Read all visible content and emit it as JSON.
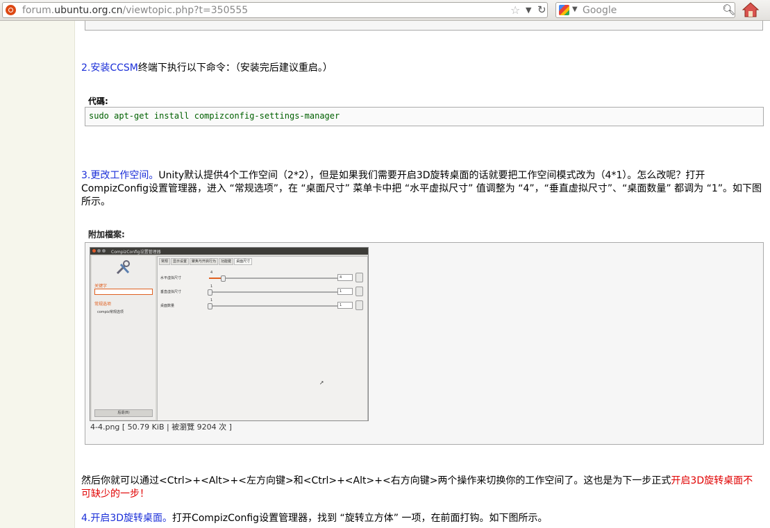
{
  "browser": {
    "url_prefix": "forum.",
    "url_domain": "ubuntu.org.cn",
    "url_suffix": "/viewtopic.php?t=350555",
    "search_placeholder": "Google"
  },
  "post": {
    "step2_link": "2.安装CCSM",
    "step2_text": "终端下执行以下命令：（安装完后建议重启。）",
    "code_label": "代碼:",
    "code": "sudo apt-get install compizconfig-settings-manager",
    "step3_link": "3.更改工作空间。",
    "step3_text1": "Unity默认提供4个工作空间（2*2），但是如果我们需要开启3D旋转桌面的话就要把工作空间模式改为（4*1）。怎么改呢？打开",
    "step3_text2": "CompizConfig设置管理器，进入 “常规选项”，在 “桌面尺寸” 菜单卡中把 “水平虚拟尺寸” 值调整为 “4”，“垂直虚拟尺寸”、“桌面数量” 都调为 “1”。如下图",
    "step3_text3": "所示。",
    "attach_label": "附加檔案:",
    "attach_caption": "4-4.png [ 50.79 KiB | 被瀏覽 9204 次 ]",
    "para_text1": "然后你就可以通过<Ctrl>+<Alt>+<左方向键>和<Ctrl>+<Alt>+<右方向键>两个操作来切换你的工作空间了。这也是为下一步正式",
    "para_red1": "开启3D旋转桌面不",
    "para_red2": "可缺少的一步！",
    "step4_link": "4.开启3D旋转桌面。",
    "step4_text": "打开CompizConfig设置管理器，找到 “旋转立方体” 一项，在前面打钩。如下图所示。"
  },
  "screenshot": {
    "window_title": "CompizConfig设置管理器",
    "keyword_label": "关键字",
    "category_label": "常规选项",
    "sidebar_item": "compiz常规选项",
    "back_button": "后退(B)",
    "tabs": [
      "常规",
      "显示设置",
      "聚焦与开启行为",
      "功能键",
      "桌面尺寸"
    ],
    "rows": [
      {
        "label": "水平虚拟尺寸",
        "value": "4",
        "fraction": 0.1
      },
      {
        "label": "垂直虚拟尺寸",
        "value": "1",
        "fraction": 0.0
      },
      {
        "label": "桌面数量",
        "value": "1",
        "fraction": 0.0
      }
    ]
  },
  "colors": {
    "link": "#1a2ed8",
    "highlight": "#e00000",
    "code": "#006000"
  }
}
